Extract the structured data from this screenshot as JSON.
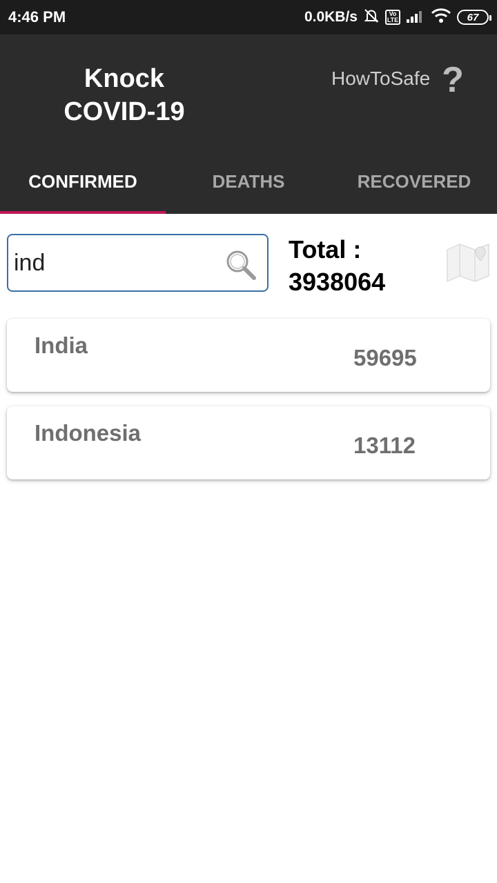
{
  "status_bar": {
    "time": "4:46 PM",
    "net_speed": "0.0KB/s",
    "volte_label": "Vo LTE",
    "battery": "67",
    "icons": [
      "mute-bell-icon",
      "volte-icon",
      "signal-icon",
      "wifi-icon",
      "battery-icon"
    ]
  },
  "header": {
    "title_line1": "Knock",
    "title_line2": "COVID-19",
    "howtosafe_label": "HowToSafe",
    "help_symbol": "?"
  },
  "tabs": [
    {
      "label": "CONFIRMED",
      "active": true
    },
    {
      "label": "DEATHS",
      "active": false
    },
    {
      "label": "RECOVERED",
      "active": false
    }
  ],
  "search": {
    "value": "ind",
    "placeholder": ""
  },
  "total": {
    "label": "Total :",
    "value": "3938064"
  },
  "results": [
    {
      "country": "India",
      "count": "59695"
    },
    {
      "country": "Indonesia",
      "count": "13112"
    }
  ],
  "colors": {
    "status_bar": "#1c1c1c",
    "header": "#2c2c2c",
    "tab_indicator": "#c2185b",
    "search_border": "#3a6ea5",
    "card_text": "#6f6f6f"
  }
}
